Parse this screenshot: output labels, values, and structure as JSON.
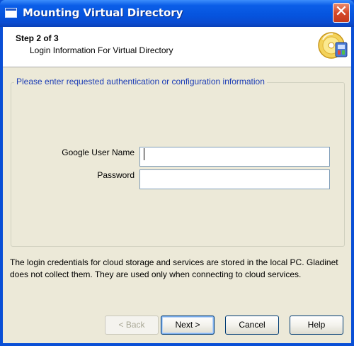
{
  "window": {
    "title": "Mounting Virtual Directory",
    "close_label": "✕"
  },
  "header": {
    "step": "Step 2 of 3",
    "subtitle": "Login Information For Virtual Directory"
  },
  "group": {
    "legend": "Please enter requested authentication or configuration information"
  },
  "form": {
    "username_label": "Google User Name",
    "username_value": "",
    "password_label": "Password",
    "password_value": ""
  },
  "note": "The login credentials for cloud storage and services are stored in the local PC. Gladinet does not collect them. They are used only when connecting to cloud services.",
  "buttons": {
    "back": "< Back",
    "next": "Next >",
    "cancel": "Cancel",
    "help": "Help"
  },
  "colors": {
    "titlebar": "#0553dd",
    "legend_text": "#1c3db5",
    "dialog_bg": "#ece9d8"
  }
}
